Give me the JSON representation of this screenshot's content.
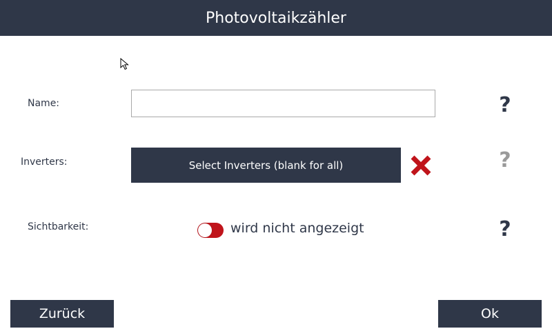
{
  "header": {
    "title": "Photovoltaikzähler"
  },
  "form": {
    "name": {
      "label": "Name:",
      "value": "",
      "placeholder": ""
    },
    "inverters": {
      "label": "Inverters:",
      "button_label": "Select Inverters (blank for all)",
      "clear_icon": "close-icon"
    },
    "visibility": {
      "label": "Sichtbarkeit:",
      "toggle_state": "off",
      "status_text": "wird nicht angezeigt"
    },
    "help_glyph": "?"
  },
  "footer": {
    "back_label": "Zurück",
    "ok_label": "Ok"
  },
  "colors": {
    "primary_dark": "#2f3748",
    "danger_red": "#c0141b",
    "muted_grey": "#9a9a9a"
  }
}
